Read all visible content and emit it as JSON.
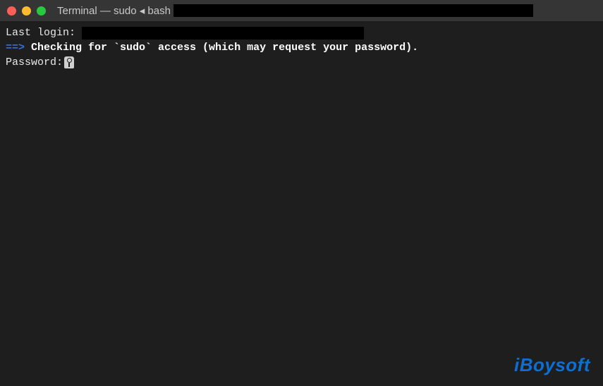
{
  "title_bar": {
    "window_title": "Terminal — sudo ◂ bash"
  },
  "terminal": {
    "last_login_label": "Last login: ",
    "arrow": "==> ",
    "checking_message": "Checking for `sudo` access (which may request your password).",
    "password_prompt": "Password:"
  },
  "watermark": {
    "text": "iBoysoft"
  }
}
